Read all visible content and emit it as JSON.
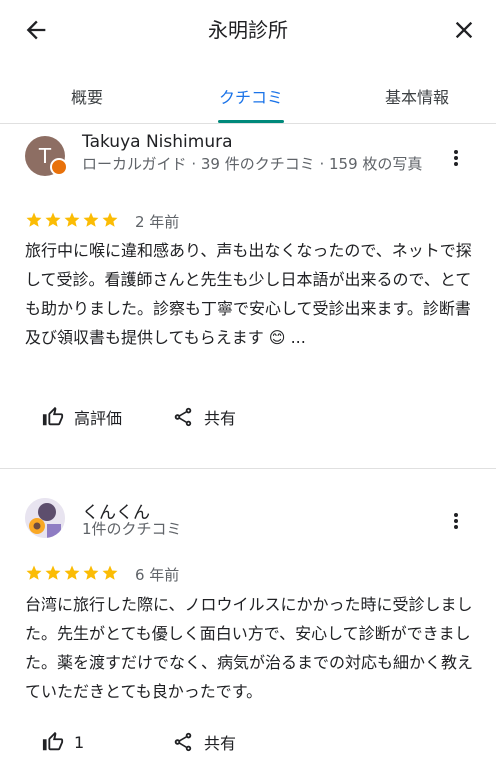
{
  "header": {
    "title": "永明診所",
    "back_icon": "arrow-back-icon",
    "close_icon": "close-icon"
  },
  "tabs": [
    {
      "label": "概要",
      "active": false
    },
    {
      "label": "クチコミ",
      "active": true
    },
    {
      "label": "基本情報",
      "active": false
    }
  ],
  "accent_color": "#1a73e8",
  "reviews": [
    {
      "avatar_letter": "T",
      "name": "Takuya Nishimura",
      "meta": "ローカルガイド · 39 件のクチコミ · 159 枚の写真",
      "rating": 5,
      "age": "2 年前",
      "text": "旅行中に喉に違和感あり、声も出なくなったので、ネットで探して受診。看護師さんと先生も少し日本語が出来るので、とても助かりました。診察も丁寧で安心して受診出来ます。診断書及び領収書も提供してもらえます 😊 ...",
      "like_label": "高評価",
      "share_label": "共有"
    },
    {
      "name": "くんくん",
      "meta": "1件のクチコミ",
      "rating": 5,
      "age": "6 年前",
      "text": "台湾に旅行した際に、ノロウイルスにかかった時に受診しました。先生がとても優しく面白い方で、安心して診断ができました。薬を渡すだけでなく、病気が治るまでの対応も細かく教えていただきとても良かったです。",
      "like_label": "1",
      "share_label": "共有"
    }
  ]
}
